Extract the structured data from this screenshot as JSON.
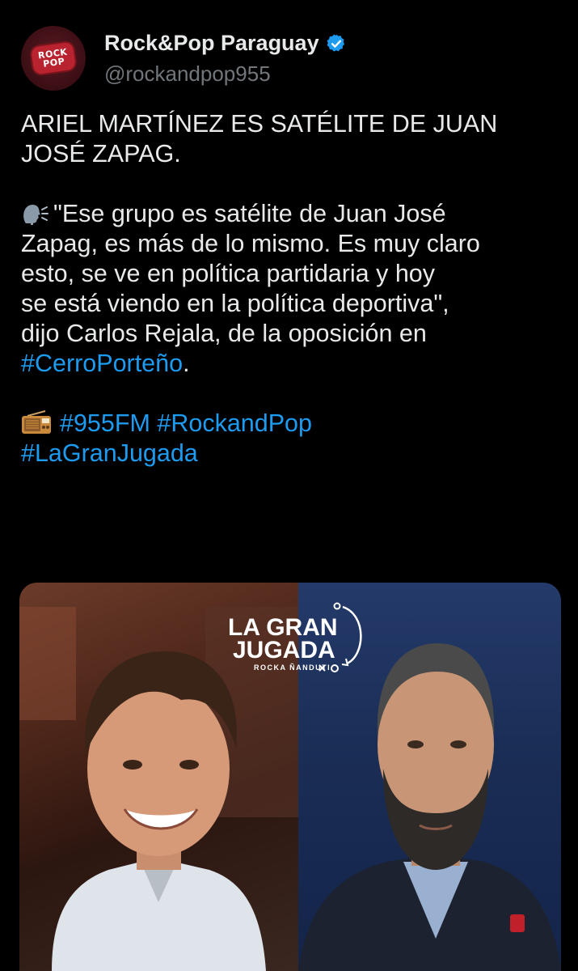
{
  "account": {
    "display_name": "Rock&Pop Paraguay",
    "handle": "@rockandpop955",
    "avatar_text_line1": "ROCK",
    "avatar_text_line2": "POP",
    "verified_color": "#1d9bf0"
  },
  "tweet": {
    "headline_line1": "ARIEL MARTÍNEZ ES SATÉLITE DE JUAN",
    "headline_line2": "JOSÉ ZAPAG.",
    "quote_line1": "\"Ese grupo es satélite de Juan José",
    "quote_line2": "Zapag, es más de lo mismo. Es muy claro",
    "quote_line3": "esto, se ve en política partidaria y hoy",
    "quote_line4": "se está viendo en la política deportiva\",",
    "quote_line5": "dijo Carlos Rejala, de la oposición en",
    "hashtag_cerro": "#CerroPorteño",
    "hashtag_cerro_suffix": ".",
    "hashtag_955fm": "#955FM",
    "hashtag_rockandpop": "#RockandPop",
    "hashtag_lagranjugada": "#LaGranJugada",
    "emoji_quote": "speaking-head-icon",
    "emoji_radio": "radio-icon"
  },
  "media": {
    "brand_line1": "LA GRAN",
    "brand_line2": "JUGADA",
    "brand_line3": "ROCKA ÑANDUTI",
    "accent_text": "#1d9bf0"
  }
}
